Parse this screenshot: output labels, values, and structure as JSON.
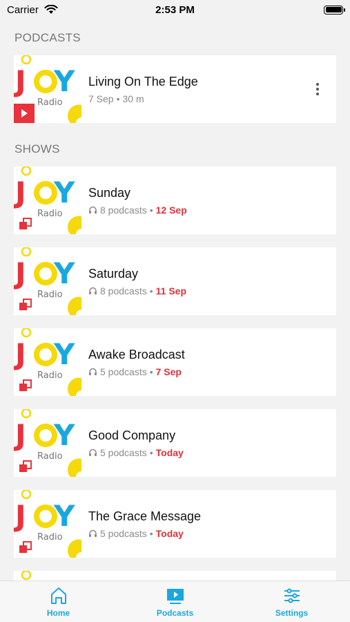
{
  "status_bar": {
    "carrier": "Carrier",
    "time": "2:53 PM"
  },
  "sections": {
    "podcasts_header": "PODCASTS",
    "shows_header": "SHOWS"
  },
  "podcasts": [
    {
      "title": "Living On The Edge",
      "date": "7 Sep",
      "duration": "30 m"
    }
  ],
  "shows": [
    {
      "title": "Sunday",
      "count": "8 podcasts",
      "date": "12 Sep"
    },
    {
      "title": "Saturday",
      "count": "8 podcasts",
      "date": "11 Sep"
    },
    {
      "title": "Awake Broadcast",
      "count": "5 podcasts",
      "date": "7 Sep"
    },
    {
      "title": "Good Company",
      "count": "5 podcasts",
      "date": "Today"
    },
    {
      "title": "The Grace Message",
      "count": "5 podcasts",
      "date": "Today"
    }
  ],
  "logo": {
    "text": "JOY",
    "subtext": "Radio"
  },
  "tabs": [
    {
      "label": "Home",
      "icon": "home-icon"
    },
    {
      "label": "Podcasts",
      "icon": "podcasts-icon"
    },
    {
      "label": "Settings",
      "icon": "settings-icon"
    }
  ],
  "colors": {
    "accent": "#1aa7df",
    "date_red": "#e0303a",
    "joy_red": "#e8323c",
    "joy_yellow": "#f5d90a",
    "joy_blue": "#1aa7df"
  }
}
